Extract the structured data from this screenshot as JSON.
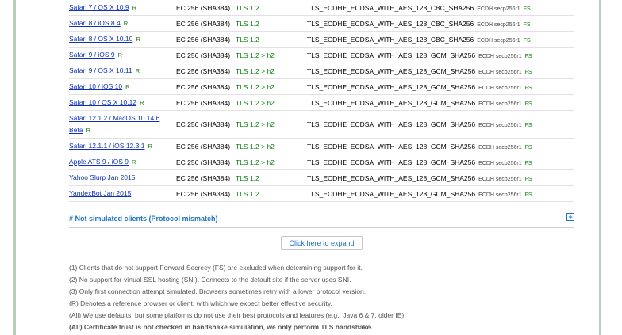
{
  "rows": [
    {
      "client": "Safari 7 / OS X 10.9",
      "ref": "R",
      "cert": "EC 256 (SHA384)",
      "protocol": "TLS 1.2",
      "suite": "TLS_ECDHE_ECDSA_WITH_AES_128_CBC_SHA256",
      "kx": "ECDH secp256r1",
      "fs": "FS"
    },
    {
      "client": "Safari 8 / iOS 8.4",
      "ref": "R",
      "cert": "EC 256 (SHA384)",
      "protocol": "TLS 1.2",
      "suite": "TLS_ECDHE_ECDSA_WITH_AES_128_CBC_SHA256",
      "kx": "ECDH secp256r1",
      "fs": "FS"
    },
    {
      "client": "Safari 8 / OS X 10.10",
      "ref": "R",
      "cert": "EC 256 (SHA384)",
      "protocol": "TLS 1.2",
      "suite": "TLS_ECDHE_ECDSA_WITH_AES_128_CBC_SHA256",
      "kx": "ECDH secp256r1",
      "fs": "FS"
    },
    {
      "client": "Safari 9 / iOS 9",
      "ref": "R",
      "cert": "EC 256 (SHA384)",
      "protocol": "TLS 1.2 > h2",
      "suite": "TLS_ECDHE_ECDSA_WITH_AES_128_GCM_SHA256",
      "kx": "ECDH secp256r1",
      "fs": "FS"
    },
    {
      "client": "Safari 9 / OS X 10.11",
      "ref": "R",
      "cert": "EC 256 (SHA384)",
      "protocol": "TLS 1.2 > h2",
      "suite": "TLS_ECDHE_ECDSA_WITH_AES_128_GCM_SHA256",
      "kx": "ECDH secp256r1",
      "fs": "FS"
    },
    {
      "client": "Safari 10 / iOS 10",
      "ref": "R",
      "cert": "EC 256 (SHA384)",
      "protocol": "TLS 1.2 > h2",
      "suite": "TLS_ECDHE_ECDSA_WITH_AES_128_GCM_SHA256",
      "kx": "ECDH secp256r1",
      "fs": "FS"
    },
    {
      "client": "Safari 10 / OS X 10.12",
      "ref": "R",
      "cert": "EC 256 (SHA384)",
      "protocol": "TLS 1.2 > h2",
      "suite": "TLS_ECDHE_ECDSA_WITH_AES_128_GCM_SHA256",
      "kx": "ECDH secp256r1",
      "fs": "FS"
    },
    {
      "client": "Safari 12.1.2 / MacOS 10.14.6 Beta",
      "ref": "R",
      "cert": "EC 256 (SHA384)",
      "protocol": "TLS 1.2 > h2",
      "suite": "TLS_ECDHE_ECDSA_WITH_AES_128_GCM_SHA256",
      "kx": "ECDH secp256r1",
      "fs": "FS"
    },
    {
      "client": "Safari 12.1.1 / iOS 12.3.1",
      "ref": "R",
      "cert": "EC 256 (SHA384)",
      "protocol": "TLS 1.2 > h2",
      "suite": "TLS_ECDHE_ECDSA_WITH_AES_128_GCM_SHA256",
      "kx": "ECDH secp256r1",
      "fs": "FS"
    },
    {
      "client": "Apple ATS 9 / iOS 9",
      "ref": "R",
      "cert": "EC 256 (SHA384)",
      "protocol": "TLS 1.2 > h2",
      "suite": "TLS_ECDHE_ECDSA_WITH_AES_128_GCM_SHA256",
      "kx": "ECDH secp256r1",
      "fs": "FS"
    },
    {
      "client": "Yahoo Slurp Jan 2015",
      "ref": "",
      "cert": "EC 256 (SHA384)",
      "protocol": "TLS 1.2",
      "suite": "TLS_ECDHE_ECDSA_WITH_AES_128_GCM_SHA256",
      "kx": "ECDH secp256r1",
      "fs": "FS"
    },
    {
      "client": "YandexBot Jan 2015",
      "ref": "",
      "cert": "EC 256 (SHA384)",
      "protocol": "TLS 1.2",
      "suite": "TLS_ECDHE_ECDSA_WITH_AES_128_GCM_SHA256",
      "kx": "ECDH secp256r1",
      "fs": "FS"
    }
  ],
  "section": {
    "title": "# Not simulated clients (Protocol mismatch)",
    "expand_icon": "plus-box-icon"
  },
  "expand_button": "Click here to expand",
  "notes": [
    "(1) Clients that do not support Forward Secrecy (FS) are excluded when determining support for it.",
    "(2) No support for virtual SSL hosting (SNI). Connects to the default site if the server uses SNI.",
    "(3) Only first connection attempt simulated. Browsers sometimes retry with a lower protocol version.",
    "(R) Denotes a reference browser or client, with which we expect better effective security.",
    "(All) We use defaults, but some platforms do not use their best protocols and features (e.g., Java 6 & 7, older IE).",
    "(All) Certificate trust is not checked in handshake simulation, we only perform TLS handshake."
  ],
  "colors": {
    "link": "#1033b5",
    "protocol": "#0d7d0d",
    "section": "#1d73c7",
    "frame": "#b5d1b8"
  }
}
